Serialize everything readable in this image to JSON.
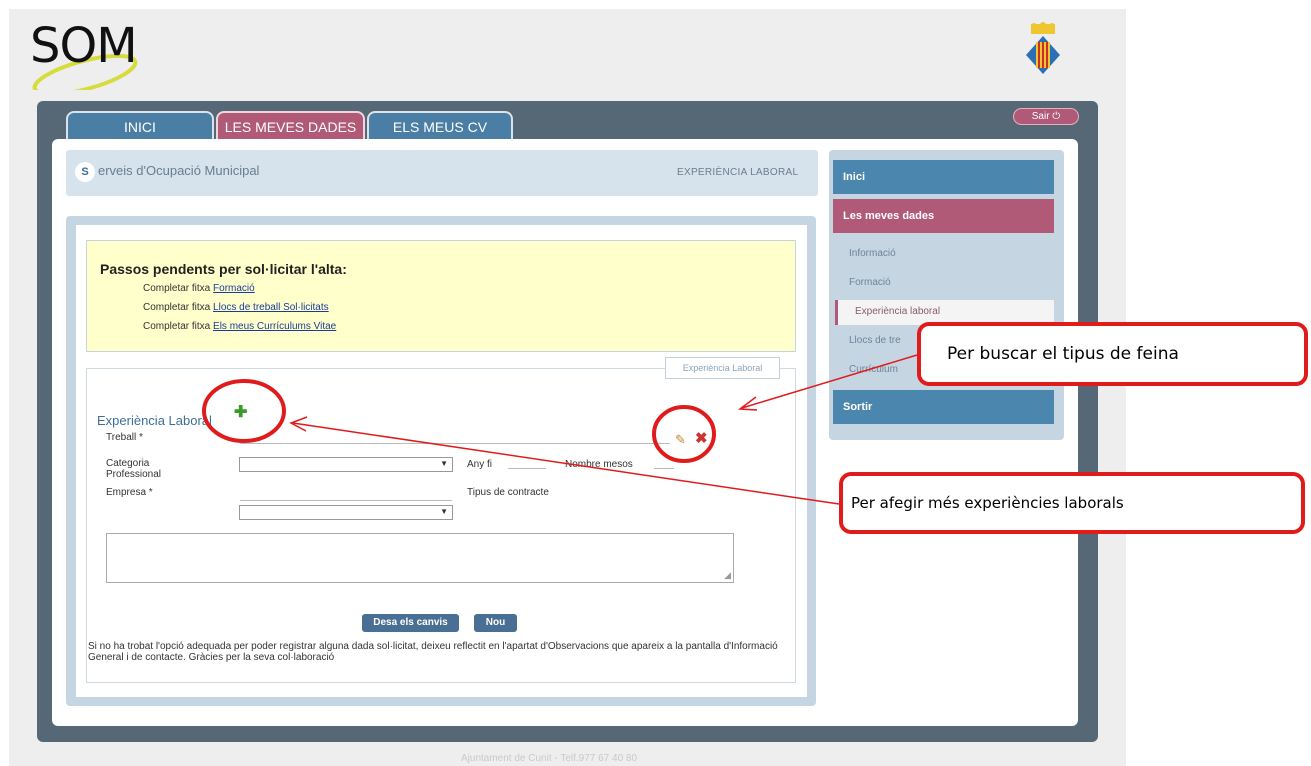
{
  "logo": {
    "text": "SOM"
  },
  "tabs": [
    {
      "label": "INICI"
    },
    {
      "label": "LES MEVES DADES"
    },
    {
      "label": "ELS MEUS CV"
    }
  ],
  "sortir_pill": "Sair ⏻",
  "header": {
    "badge": "S",
    "title": "erveis d'Ocupació Municipal",
    "section": "EXPERIÈNCIA LABORAL"
  },
  "pending": {
    "title": "Passos pendents per sol·licitar l'alta:",
    "prefix": "Completar fitxa",
    "lines": [
      {
        "link": "Formació"
      },
      {
        "link": "Llocs de treball Sol·licitats"
      },
      {
        "link": "Els meus Currículums Vitae"
      }
    ]
  },
  "form": {
    "legend": "Experiència Laboral",
    "section_title": "Experiència Laboral",
    "labels": {
      "treball": "Treball *",
      "categoria": "Categoria Professional",
      "any_fi": "Any fi",
      "nombre_mesos": "Nombre mesos",
      "empresa": "Empresa *",
      "tipus_contracte": "Tipus de contracte"
    },
    "buttons": {
      "desa": "Desa els canvis",
      "nou": "Nou"
    },
    "footnote": "Si no ha trobat l'opció adequada per poder registrar alguna dada sol·licitat, deixeu reflectit en l'apartat d'Observacions que apareix a la pantalla d'Informació General i de contacte. Gràcies per la seva col·laboració"
  },
  "sidebar": {
    "inici": "Inici",
    "dades": "Les meves dades",
    "items": [
      {
        "label": "Informació"
      },
      {
        "label": "Formació"
      },
      {
        "label": "Experiència laboral"
      },
      {
        "label": "Llocs de tre"
      },
      {
        "label": "Currículum"
      }
    ],
    "sortir": "Sortir"
  },
  "callouts": {
    "buscar": "Per buscar el tipus de feina",
    "afegir": "Per afegir més experiències laborals"
  },
  "footer": "Ajuntament de Cunit - Telf.977 67 40 80",
  "colors": {
    "accent_red": "#e01b1b",
    "tab_blue": "#4a7ea4",
    "tab_pink": "#b15a78",
    "frame": "#566776"
  }
}
